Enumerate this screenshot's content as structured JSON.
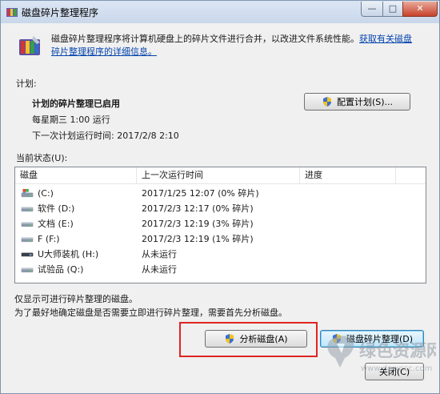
{
  "window": {
    "title": "磁盘碎片整理程序",
    "buttons": {
      "minimize": "—",
      "maximize": "□",
      "close": "✕"
    }
  },
  "description": {
    "text": "磁盘碎片整理程序将计算机硬盘上的碎片文件进行合并，以改进文件系统性能。",
    "link": "获取有关磁盘碎片整理程序的详细信息。"
  },
  "schedule": {
    "section_label": "计划:",
    "status": "计划的碎片整理已启用",
    "frequency": "每星期三  1:00 运行",
    "next_run": "下一次计划运行时间: 2017/2/8 2:10",
    "configure_button": "配置计划(S)..."
  },
  "current_status": {
    "section_label": "当前状态(U):",
    "columns": [
      "磁盘",
      "上一次运行时间",
      "进度"
    ],
    "rows": [
      {
        "disk": "(C:)",
        "icon": "system-drive-icon",
        "last_run": "2017/1/25 12:07 (0% 碎片)",
        "progress": ""
      },
      {
        "disk": "软件 (D:)",
        "icon": "hard-drive-icon",
        "last_run": "2017/2/3 12:17 (0% 碎片)",
        "progress": ""
      },
      {
        "disk": "文档 (E:)",
        "icon": "hard-drive-icon",
        "last_run": "2017/2/3 12:19 (3% 碎片)",
        "progress": ""
      },
      {
        "disk": "F (F:)",
        "icon": "hard-drive-icon",
        "last_run": "2017/2/3 12:19 (1% 碎片)",
        "progress": ""
      },
      {
        "disk": "U大师装机 (H:)",
        "icon": "usb-drive-icon",
        "last_run": "从未运行",
        "progress": ""
      },
      {
        "disk": "试验品 (Q:)",
        "icon": "hard-drive-icon",
        "last_run": "从未运行",
        "progress": ""
      }
    ]
  },
  "notes": {
    "line1": "仅显示可进行碎片整理的磁盘。",
    "line2": "为了最好地确定磁盘是否需要立即进行碎片整理，需要首先分析磁盘。"
  },
  "actions": {
    "analyze_button": "分析磁盘(A)",
    "defrag_button": "磁盘碎片整理(D)",
    "close_button": "关闭(C)"
  },
  "watermark": {
    "brand": "绿色资源网",
    "url": "www.downcc.com"
  },
  "colors": {
    "accent_link": "#0645ad",
    "highlight_border": "#e02424"
  }
}
